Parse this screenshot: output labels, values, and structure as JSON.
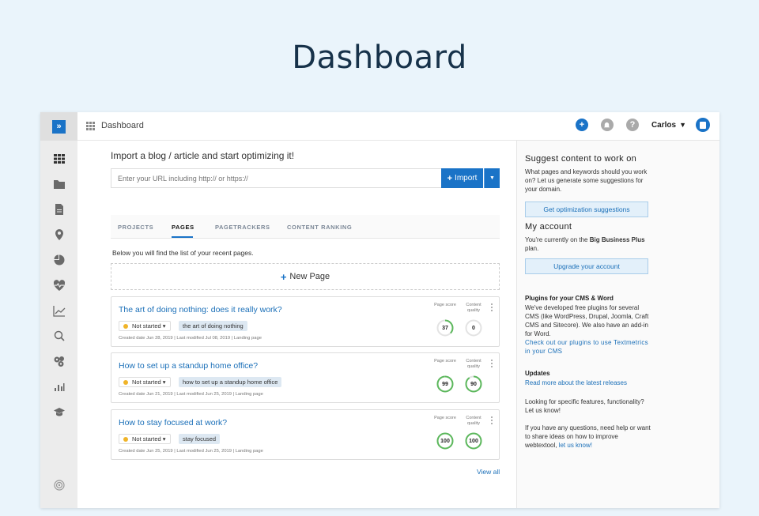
{
  "hero": {
    "title": "Dashboard"
  },
  "topbar": {
    "title": "Dashboard",
    "user": "Carlos"
  },
  "colors": {
    "accent": "#1a73c7",
    "gauge_green": "#5cb85c",
    "status_yellow": "#f0b429"
  },
  "sidebar": {
    "items": [
      "dashboard-grid-icon",
      "folder-icon",
      "document-icon",
      "location-pin-icon",
      "pie-chart-icon",
      "heart-pulse-icon",
      "trend-icon",
      "search-icon",
      "settings-group-icon",
      "bar-chart-icon",
      "graduation-cap-icon",
      "gear-icon"
    ]
  },
  "main": {
    "import_title": "Import a blog / article and start optimizing it!",
    "url_placeholder": "Enter your URL including http:// or https://",
    "import_label": "Import",
    "tabs": [
      {
        "label": "PROJECTS"
      },
      {
        "label": "PAGES"
      },
      {
        "label": "PAGETRACKERS"
      },
      {
        "label": "CONTENT RANKING"
      }
    ],
    "active_tab": "PAGES",
    "intro": "Below you will find the list of your recent pages.",
    "new_page": "New Page",
    "page_score_label": "Page score",
    "content_quality_label": "Content quality",
    "cards": [
      {
        "title": "The art of doing nothing: does it really work?",
        "status": "Not started",
        "keyword": "the art of doing nothing",
        "meta": "Created date Jun 28, 2019  |  Last modified Jul 08, 2019  |  Landing page",
        "page_score": "37",
        "content_quality": "0",
        "page_score_value": 37,
        "content_quality_value": 0
      },
      {
        "title": "How to set up a standup home office?",
        "status": "Not started",
        "keyword": "how to set up a standup home office",
        "meta": "Created date Jun 21, 2019  |  Last modified Jun 25, 2019  |  Landing page",
        "page_score": "99",
        "content_quality": "90",
        "page_score_value": 99,
        "content_quality_value": 90
      },
      {
        "title": "How to stay focused at work?",
        "status": "Not started",
        "keyword": "stay focused",
        "meta": "Created date Jun 25, 2019  |  Last modified Jun 25, 2019  |  Landing page",
        "page_score": "100",
        "content_quality": "100",
        "page_score_value": 100,
        "content_quality_value": 100
      }
    ],
    "view_all": "View all"
  },
  "right": {
    "suggest_title": "Suggest content to work on",
    "suggest_text": "What pages and keywords should you work on? Let us generate some suggestions for your domain.",
    "suggest_button": "Get optimization suggestions",
    "account_title": "My account",
    "account_text_prefix": "You're currently on the ",
    "account_plan": "Big Business Plus",
    "account_text_suffix": " plan.",
    "upgrade_button": "Upgrade your account",
    "plugins_title": "Plugins for your CMS & Word",
    "plugins_text": "We've developed free plugins for several CMS (like WordPress, Drupal, Joomla, Craft CMS and Sitecore). We also have an add-in for Word.",
    "plugins_link": "Check out our plugins to use Textmetrics in your CMS",
    "updates_title": "Updates",
    "updates_link": "Read more about the latest releases",
    "features_text": "Looking for specific features, functionality? Let us know!",
    "help_text": "If you have any questions, need help or want to share ideas on how to improve webtextool, ",
    "help_link": "let us know!"
  }
}
